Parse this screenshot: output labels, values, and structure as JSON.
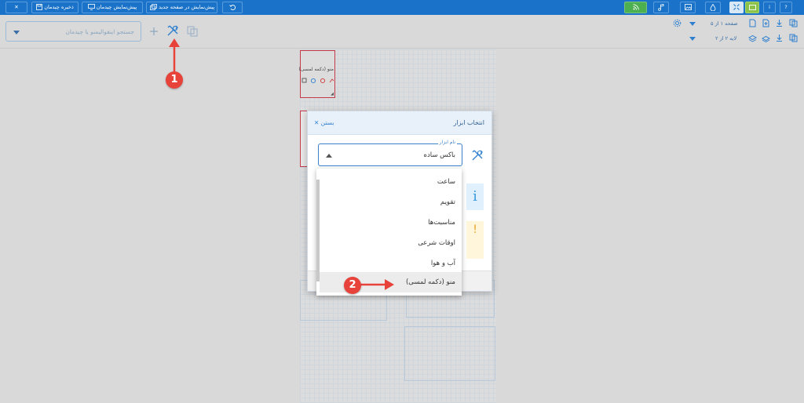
{
  "topbar": {
    "close": "✕",
    "save_layout": "ذخیره چیدمان",
    "preview_layout": "پیش‌نمایش چیدمان",
    "preview_new_page": "پیش‌نمایش در صفحه جدید",
    "help": "?",
    "info": "i"
  },
  "toolbar": {
    "search_placeholder": "جستجو اینفوالیمنو یا چیدمان",
    "page_info": "صفحه ۱ از ۵",
    "layer_info": "لایه ۲ از ۲"
  },
  "canvas": {
    "widget_label": "منو (دکمه لمسی)"
  },
  "modal": {
    "title": "انتخاب ابزار",
    "close_label": "بستن",
    "field_label": "نام ابزار",
    "field_value": "باکس ساده",
    "info_glyph": "i",
    "warning_glyph": "!"
  },
  "dropdown": {
    "items": [
      {
        "label": "ساعت"
      },
      {
        "label": "تقویم"
      },
      {
        "label": "مناسبت‌ها"
      },
      {
        "label": "اوقات شرعی"
      },
      {
        "label": "آب و هوا"
      },
      {
        "label": "منو (دکمه لمسی)"
      }
    ]
  },
  "annotations": {
    "step1": "1",
    "step2": "2"
  },
  "colors": {
    "topbar": "#1a73c8",
    "accent": "#3b82c9",
    "badge": "#e8433b",
    "green_button": "#4caf50"
  }
}
